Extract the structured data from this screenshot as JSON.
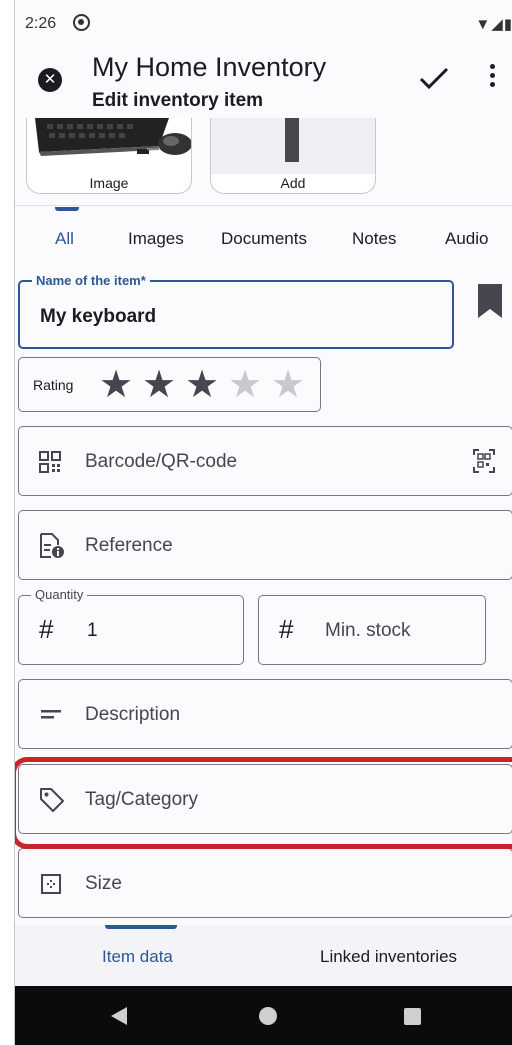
{
  "status_bar": {
    "time": "2:26",
    "icons": "▼◢▮"
  },
  "app_bar": {
    "title": "My Home Inventory",
    "subtitle": "Edit inventory item"
  },
  "images": [
    {
      "label": "Image"
    },
    {
      "label": "Add"
    }
  ],
  "tabs": [
    {
      "label": "All",
      "active": true
    },
    {
      "label": "Images"
    },
    {
      "label": "Documents"
    },
    {
      "label": "Notes"
    },
    {
      "label": "Audio"
    }
  ],
  "form": {
    "name": {
      "legend": "Name of the item*",
      "value": "My keyboard"
    },
    "rating": {
      "label": "Rating",
      "value": 3,
      "max": 5
    },
    "barcode": {
      "label": "Barcode/QR-code"
    },
    "reference": {
      "label": "Reference"
    },
    "quantity": {
      "legend": "Quantity",
      "value": "1"
    },
    "min_stock": {
      "label": "Min. stock"
    },
    "description": {
      "label": "Description"
    },
    "tag": {
      "label": "Tag/Category"
    },
    "size": {
      "label": "Size"
    }
  },
  "bottom_nav": [
    {
      "label": "Item data",
      "active": true
    },
    {
      "label": "Linked inventories"
    }
  ],
  "colors": {
    "accent": "#2b5797",
    "highlight": "#c8252a",
    "star_on": "#45464f",
    "star_off": "#c9c8cd"
  }
}
